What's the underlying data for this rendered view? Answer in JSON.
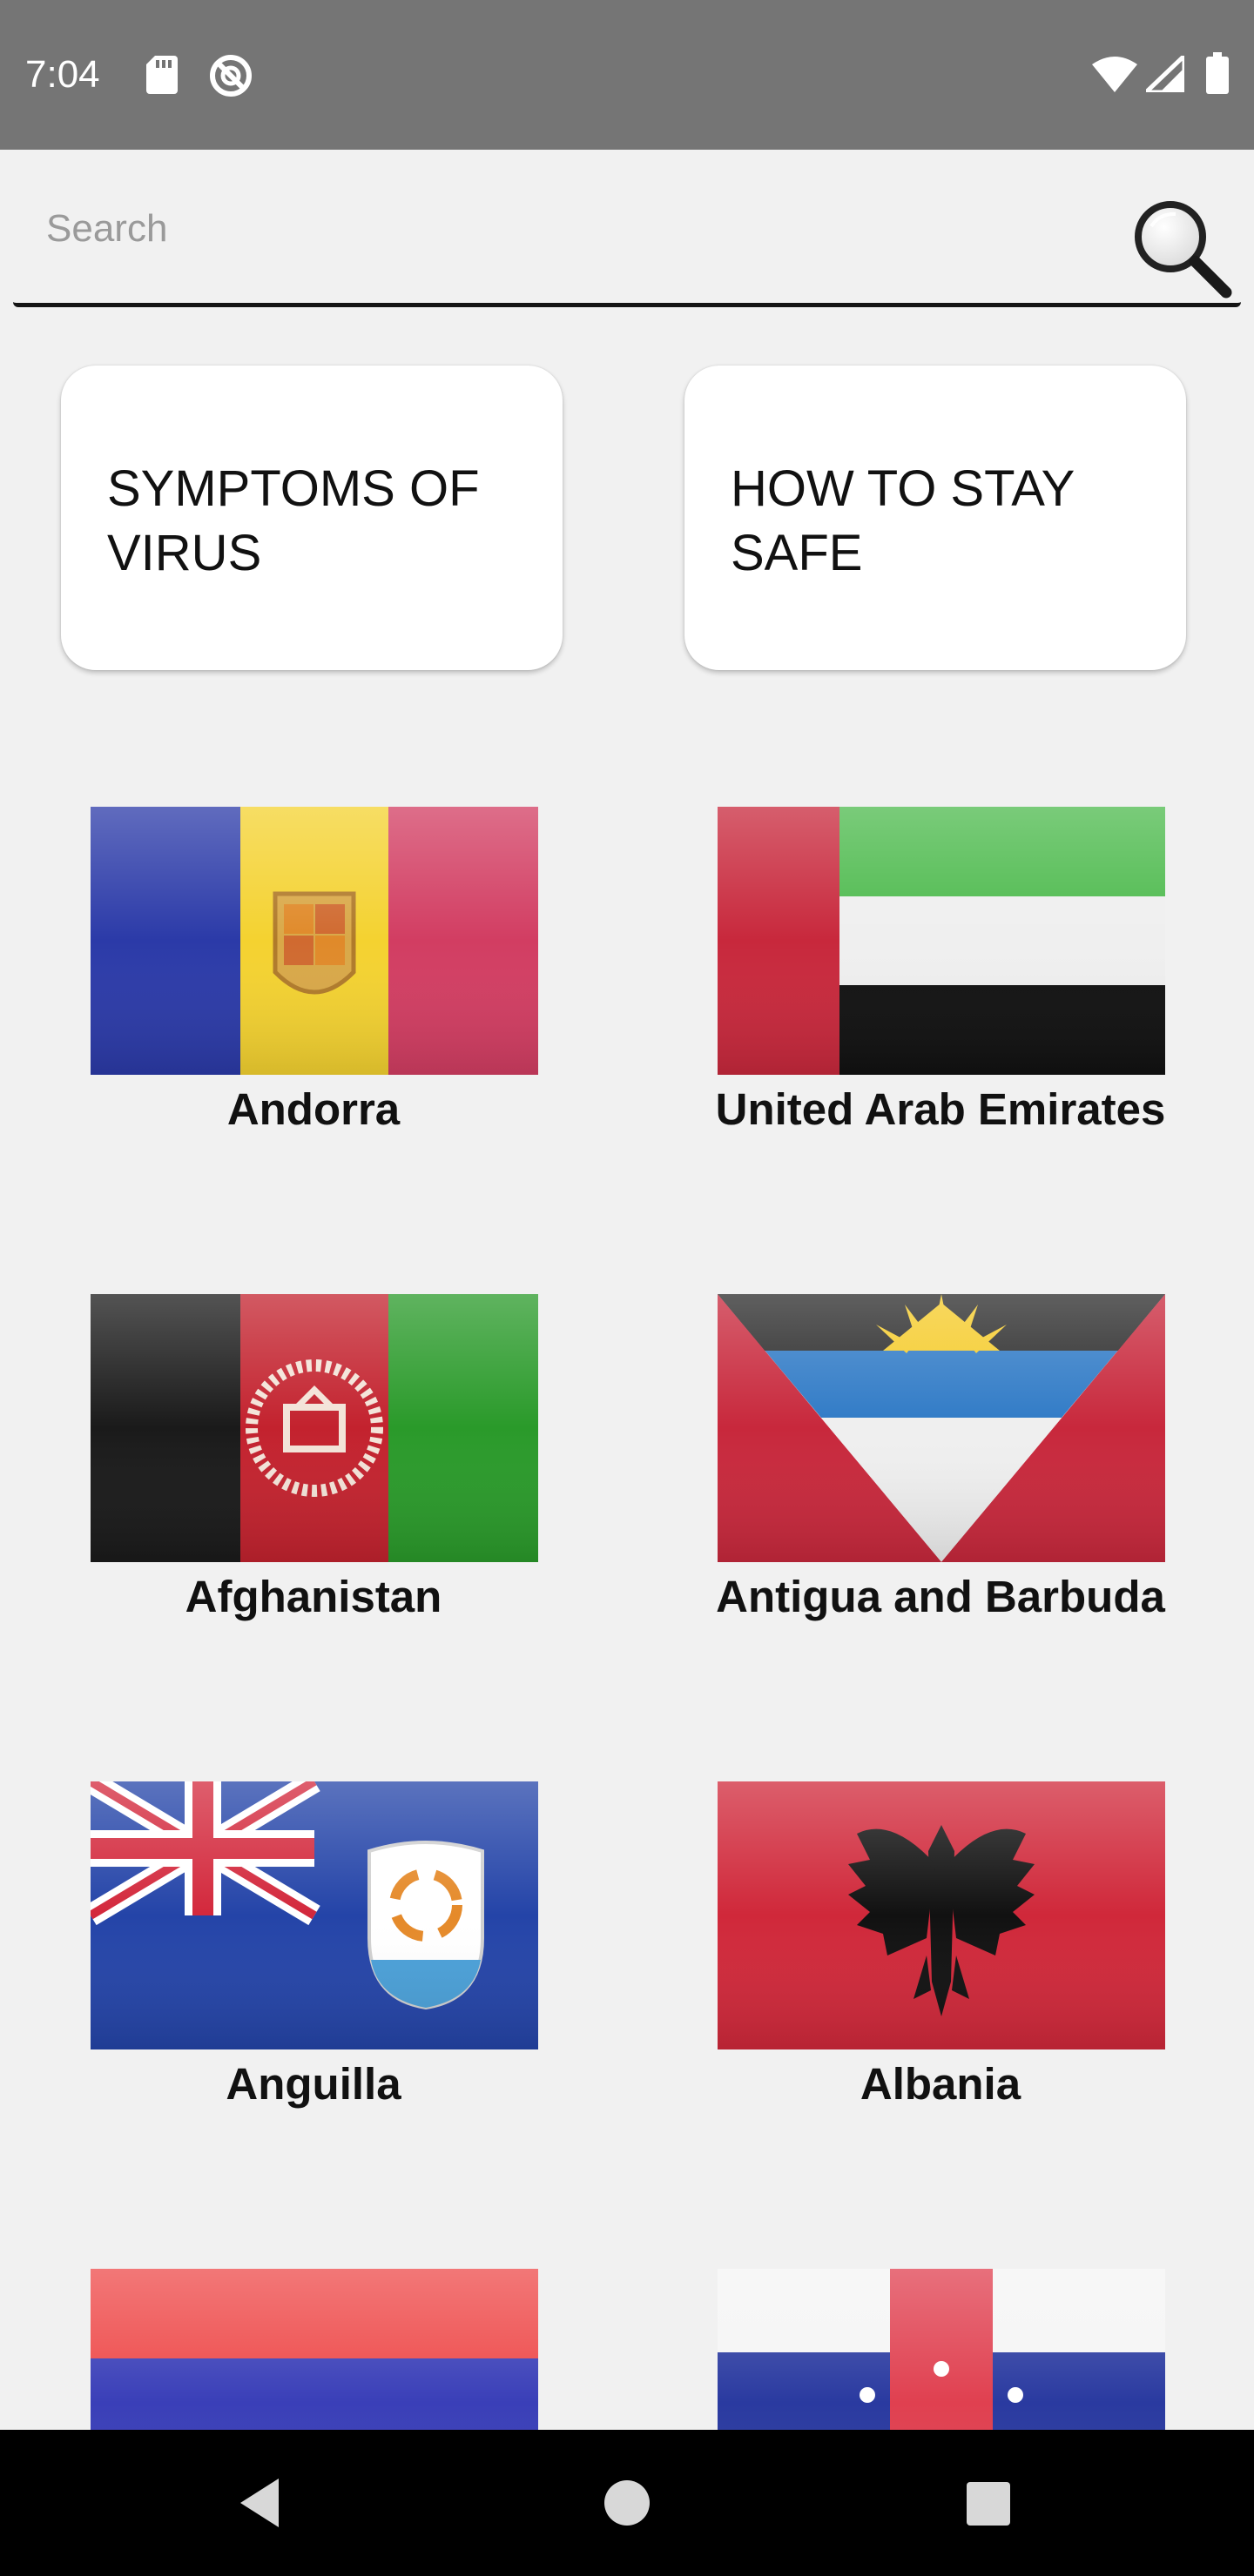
{
  "status_bar": {
    "time": "7:04",
    "icons": [
      "sd-card-icon",
      "no-sync-icon",
      "wifi-icon",
      "cellular-signal-icon",
      "battery-icon"
    ]
  },
  "search": {
    "placeholder": "Search",
    "value": "",
    "icon": "magnifier-icon"
  },
  "info_buttons": {
    "symptoms_label": "SYMPTOMS OF VIRUS",
    "stay_safe_label": "HOW TO STAY SAFE"
  },
  "countries": [
    {
      "name": "Andorra",
      "flag": "andorra-flag"
    },
    {
      "name": "United Arab Emirates",
      "flag": "uae-flag"
    },
    {
      "name": "Afghanistan",
      "flag": "afghanistan-flag"
    },
    {
      "name": "Antigua and Barbuda",
      "flag": "antigua-barbuda-flag"
    },
    {
      "name": "Anguilla",
      "flag": "anguilla-flag"
    },
    {
      "name": "Albania",
      "flag": "albania-flag"
    },
    {
      "name": "",
      "flag": "armenia-flag"
    },
    {
      "name": "",
      "flag": "netherlands-antilles-flag"
    }
  ],
  "nav_bar": {
    "icons": [
      "back-icon",
      "home-icon",
      "recents-icon"
    ]
  },
  "colors": {
    "status_bar": "#757575",
    "background": "#f1f1f1",
    "nav_bar": "#000000",
    "card": "#ffffff"
  }
}
